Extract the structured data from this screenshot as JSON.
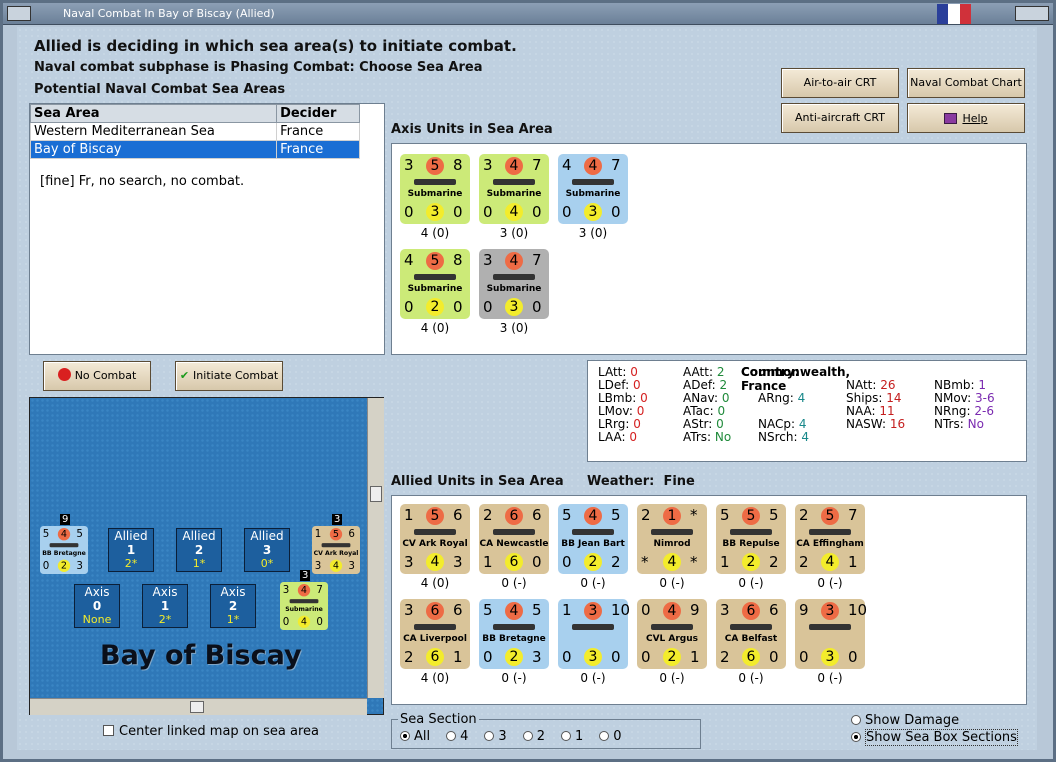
{
  "window": {
    "title": "Naval Combat In Bay of Biscay (Allied)"
  },
  "header": {
    "line1": "Allied is deciding in which sea area(s) to initiate combat.",
    "line2": "Naval combat subphase is Phasing Combat: Choose Sea Area",
    "line3": "Potential Naval Combat Sea Areas"
  },
  "buttons": {
    "air_to_air": "Air-to-air CRT",
    "naval_chart": "Naval Combat Chart",
    "anti_aircraft": "Anti-aircraft CRT",
    "help": "Help",
    "no_combat": "No Combat",
    "initiate": "Initiate Combat"
  },
  "sea_table": {
    "headers": [
      "Sea Area",
      "Decider"
    ],
    "rows": [
      [
        "Western Mediterranean Sea",
        "France"
      ],
      [
        "Bay of Biscay",
        "France"
      ]
    ],
    "note": "[fine]  Fr, no search, no combat."
  },
  "axis": {
    "title": "Axis Units in Sea Area",
    "units": [
      {
        "tl": "3",
        "tc": "5",
        "tr": "8",
        "bl": "0",
        "bc": "3",
        "br": "0",
        "name": "Submarine",
        "cap": "4 (0)",
        "color": "g"
      },
      {
        "tl": "3",
        "tc": "4",
        "tr": "7",
        "bl": "0",
        "bc": "4",
        "br": "0",
        "name": "Submarine",
        "cap": "3 (0)",
        "color": "g"
      },
      {
        "tl": "4",
        "tc": "4",
        "tr": "7",
        "bl": "0",
        "bc": "3",
        "br": "0",
        "name": "Submarine",
        "cap": "3 (0)",
        "color": "b"
      },
      {
        "tl": "4",
        "tc": "5",
        "tr": "8",
        "bl": "0",
        "bc": "2",
        "br": "0",
        "name": "Submarine",
        "cap": "4 (0)",
        "color": "g"
      },
      {
        "tl": "3",
        "tc": "4",
        "tr": "7",
        "bl": "0",
        "bc": "3",
        "br": "0",
        "name": "Submarine",
        "cap": "3 (0)",
        "color": "gy"
      }
    ]
  },
  "stats": {
    "country_label": "Country:",
    "country": "Commonwealth, France",
    "col1": [
      [
        "LAtt:",
        "0"
      ],
      [
        "LDef:",
        "0"
      ],
      [
        "LBmb:",
        "0"
      ],
      [
        "LMov:",
        "0"
      ],
      [
        "LRrg:",
        "0"
      ],
      [
        "LAA:",
        "0"
      ]
    ],
    "col2": [
      [
        "AAtt:",
        "2"
      ],
      [
        "ADef:",
        "2"
      ],
      [
        "ANav:",
        "0"
      ],
      [
        "ATac:",
        "0"
      ],
      [
        "AStr:",
        "0"
      ],
      [
        "ATrs:",
        "No"
      ]
    ],
    "col3": [
      [
        "ARng:",
        "4"
      ],
      [
        "NACp:",
        "4"
      ],
      [
        "NSrch:",
        "4"
      ]
    ],
    "col4": [
      [
        "NAtt:",
        "26"
      ],
      [
        "Ships:",
        "14"
      ],
      [
        "NAA:",
        "11"
      ],
      [
        "NASW:",
        "16"
      ]
    ],
    "col5": [
      [
        "NBmb:",
        "1"
      ],
      [
        "NMov:",
        "3-6"
      ],
      [
        "NRng:",
        "2-6"
      ],
      [
        "NTrs:",
        "No"
      ]
    ]
  },
  "allied": {
    "title": "Allied Units in Sea Area",
    "weather_label": "Weather:",
    "weather": "Fine",
    "units": [
      {
        "tl": "1",
        "tc": "5",
        "tr": "6",
        "bl": "3",
        "bc": "4",
        "br": "3",
        "name": "CV Ark Royal",
        "cap": "4 (0)",
        "color": "t"
      },
      {
        "tl": "2",
        "tc": "6",
        "tr": "6",
        "bl": "1",
        "bc": "6",
        "br": "0",
        "name": "CA Newcastle",
        "cap": "0 (-)",
        "color": "t"
      },
      {
        "tl": "5",
        "tc": "4",
        "tr": "5",
        "bl": "0",
        "bc": "2",
        "br": "2",
        "name": "BB Jean Bart",
        "cap": "0 (-)",
        "color": "b"
      },
      {
        "tl": "2",
        "tc": "1",
        "tr": "*",
        "bl": "*",
        "bc": "4",
        "br": "*",
        "name": "Nimrod",
        "cap": "0 (-)",
        "color": "t"
      },
      {
        "tl": "5",
        "tc": "5",
        "tr": "5",
        "bl": "1",
        "bc": "2",
        "br": "2",
        "name": "BB Repulse",
        "cap": "0 (-)",
        "color": "t"
      },
      {
        "tl": "2",
        "tc": "5",
        "tr": "7",
        "bl": "2",
        "bc": "4",
        "br": "1",
        "name": "CA Effingham",
        "cap": "0 (-)",
        "color": "t"
      },
      {
        "tl": "3",
        "tc": "6",
        "tr": "6",
        "bl": "2",
        "bc": "6",
        "br": "1",
        "name": "CA Liverpool",
        "cap": "4 (0)",
        "color": "t"
      },
      {
        "tl": "5",
        "tc": "4",
        "tr": "5",
        "bl": "0",
        "bc": "2",
        "br": "3",
        "name": "BB Bretagne",
        "cap": "0 (-)",
        "color": "b"
      },
      {
        "tl": "1",
        "tc": "3",
        "tr": "10",
        "bl": "0",
        "bc": "3",
        "br": "0",
        "name": "",
        "cap": "0 (-)",
        "color": "b"
      },
      {
        "tl": "0",
        "tc": "4",
        "tr": "9",
        "bl": "0",
        "bc": "2",
        "br": "1",
        "name": "CVL Argus",
        "cap": "0 (-)",
        "color": "t"
      },
      {
        "tl": "3",
        "tc": "6",
        "tr": "6",
        "bl": "2",
        "bc": "6",
        "br": "0",
        "name": "CA Belfast",
        "cap": "0 (-)",
        "color": "t"
      },
      {
        "tl": "9",
        "tc": "3",
        "tr": "10",
        "bl": "0",
        "bc": "3",
        "br": "0",
        "name": "",
        "cap": "0 (-)",
        "color": "t"
      }
    ]
  },
  "map": {
    "title": "Bay of Biscay",
    "allied_boxes": [
      {
        "label": "Allied",
        "num": "1",
        "val": "2*"
      },
      {
        "label": "Allied",
        "num": "2",
        "val": "1*"
      },
      {
        "label": "Allied",
        "num": "3",
        "val": "0*"
      }
    ],
    "axis_boxes": [
      {
        "label": "Axis",
        "num": "0",
        "val": "None"
      },
      {
        "label": "Axis",
        "num": "1",
        "val": "2*"
      },
      {
        "label": "Axis",
        "num": "2",
        "val": "1*"
      }
    ],
    "stack_left": {
      "count": "9",
      "tl": "5",
      "tc": "4",
      "tr": "5",
      "bl": "0",
      "bc": "2",
      "br": "3",
      "name": "BB Bretagne"
    },
    "stack_right": {
      "count": "3",
      "tl": "1",
      "tc": "5",
      "tr": "6",
      "bl": "3",
      "bc": "4",
      "br": "3",
      "name": "CV Ark Royal"
    },
    "stack_sub": {
      "count": "3",
      "tl": "3",
      "tc": "4",
      "tr": "7",
      "bl": "0",
      "bc": "4",
      "br": "0",
      "name": "Submarine"
    }
  },
  "footer": {
    "center_map": "Center linked map on sea area",
    "sea_section": "Sea Section",
    "sections": [
      "All",
      "4",
      "3",
      "2",
      "1",
      "0"
    ],
    "show_damage": "Show Damage",
    "show_boxes": "Show Sea Box Sections"
  },
  "colors": {
    "selection": "#1a6ed4",
    "red_circle": "#ee6b45",
    "yellow_circle": "#f3ec2c"
  }
}
